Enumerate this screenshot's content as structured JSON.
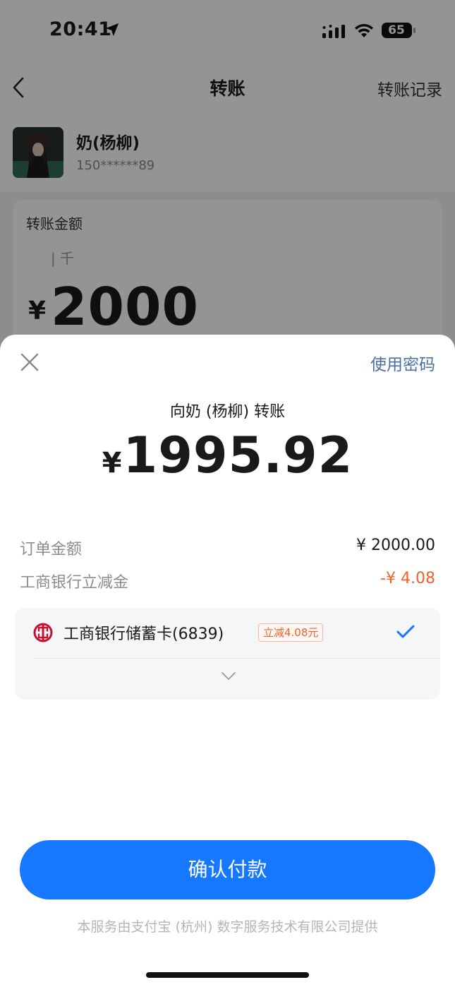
{
  "status_bar": {
    "time": "20:41",
    "battery": "65",
    "icons": [
      "location-arrow-icon",
      "signal-icon",
      "wifi-icon",
      "battery-icon"
    ]
  },
  "nav": {
    "title": "转账",
    "right_action": "转账记录"
  },
  "recipient": {
    "name": "奶(杨柳)",
    "phone": "150******89"
  },
  "amount_card": {
    "label": "转账金额",
    "unit_hint": "| 千",
    "currency": "¥",
    "amount": "2000"
  },
  "payment_sheet": {
    "use_password": "使用密码",
    "pay_to": "向奶 (杨柳) 转账",
    "currency": "¥",
    "amount": "1995.92",
    "order_label": "订单金额",
    "order_value": "¥ 2000.00",
    "discount_label": "工商银行立减金",
    "discount_value": "-¥ 4.08",
    "method": {
      "bank_name": "工商银行储蓄卡(6839)",
      "badge": "立减4.08元",
      "selected": true
    },
    "confirm_label": "确认付款",
    "footer": "本服务由支付宝 (杭州) 数字服务技术有限公司提供"
  },
  "colors": {
    "primary": "#1677ff",
    "discount": "#f0622d",
    "link": "#4a6fa5",
    "overlay": "rgba(0,0,0,0.42)"
  }
}
